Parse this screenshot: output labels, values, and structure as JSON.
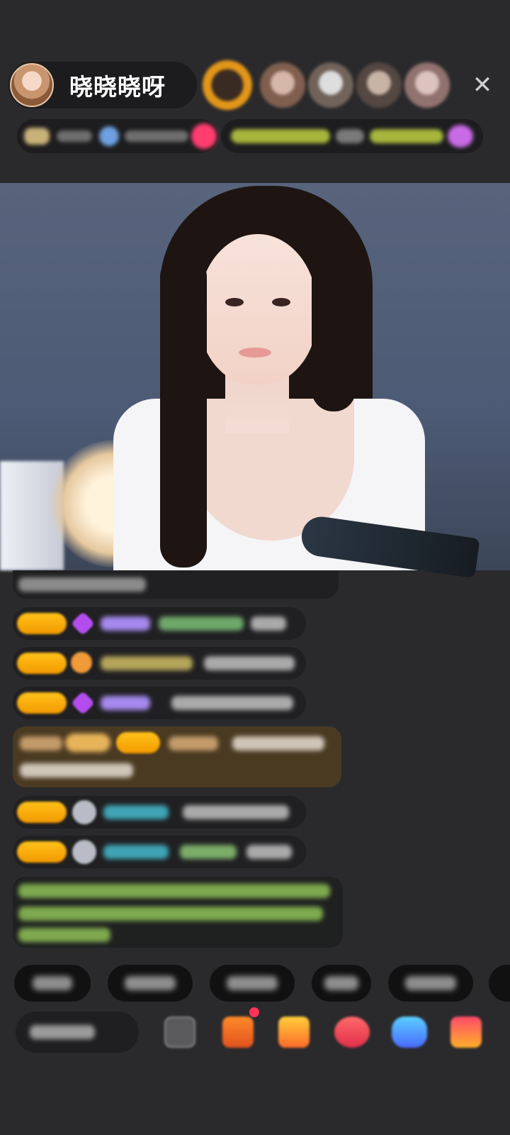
{
  "header": {
    "host_name": "晓晓晓呀",
    "close_glyph": "✕"
  },
  "colors": {
    "background": "#2a2a2c",
    "accent_badge": "#f7a40a",
    "chat_username_purple": "#b89bff",
    "chat_username_cyan": "#3ab7c8",
    "system_text_green": "#9cd463"
  },
  "icons": {
    "close": "close-icon",
    "gift": "gift-icon"
  }
}
